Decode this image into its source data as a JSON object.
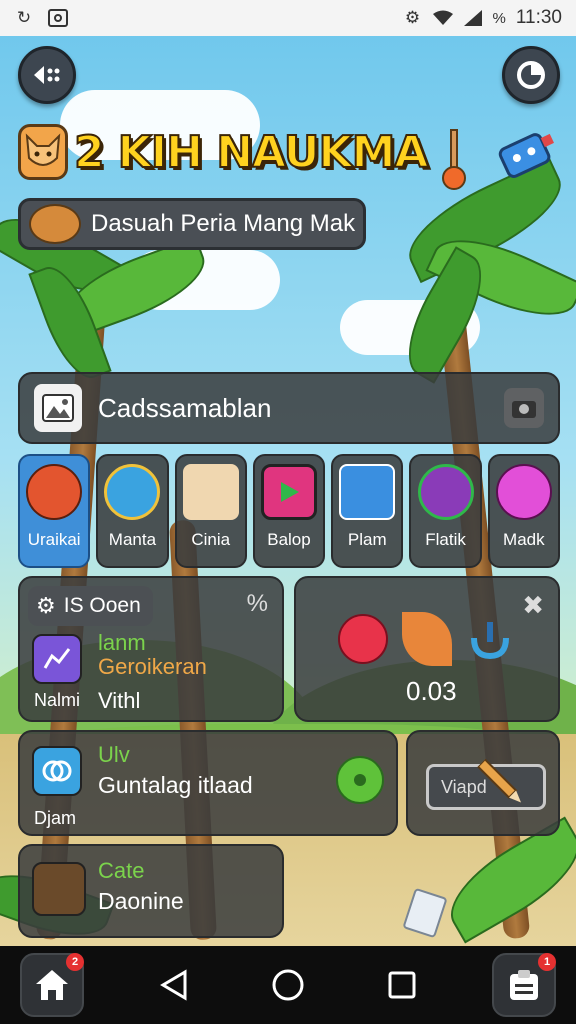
{
  "status_bar": {
    "time": "11:30",
    "battery_text": "%"
  },
  "top_buttons": {
    "left": "menu-back",
    "right": "clock"
  },
  "title": {
    "number": "2",
    "text": "KIH NAUKMA"
  },
  "subtitle": "Dasuah Peria Mang Mak",
  "section_header": {
    "label": "Cadssamablan"
  },
  "categories": [
    {
      "label": "Uraikai",
      "color": "#e3552f"
    },
    {
      "label": "Manta",
      "color": "#3aa3e0"
    },
    {
      "label": "Cinia",
      "color": "#f0d7b0"
    },
    {
      "label": "Balop",
      "color": "#e0357f"
    },
    {
      "label": "Plam",
      "color": "#3a8fe0"
    },
    {
      "label": "Flatik",
      "color": "#8a3bb8"
    },
    {
      "label": "Madk",
      "color": "#e24fd8"
    }
  ],
  "card_a": {
    "header": "IS Ooen",
    "line1": "lanm",
    "line2": "Geroikeran",
    "line3_left": "Nalmi",
    "line3_right": "Vithl"
  },
  "card_b": {
    "value": "0.03"
  },
  "card_c": {
    "tag": "Ulv",
    "title": "Guntalag itlaad",
    "footer": "Djam"
  },
  "card_d": {
    "button": "Viapd"
  },
  "card_e": {
    "title": "Cate",
    "subtitle": "Daonine"
  },
  "nav": {
    "home_badge": "2",
    "clipboard_badge": "1"
  }
}
